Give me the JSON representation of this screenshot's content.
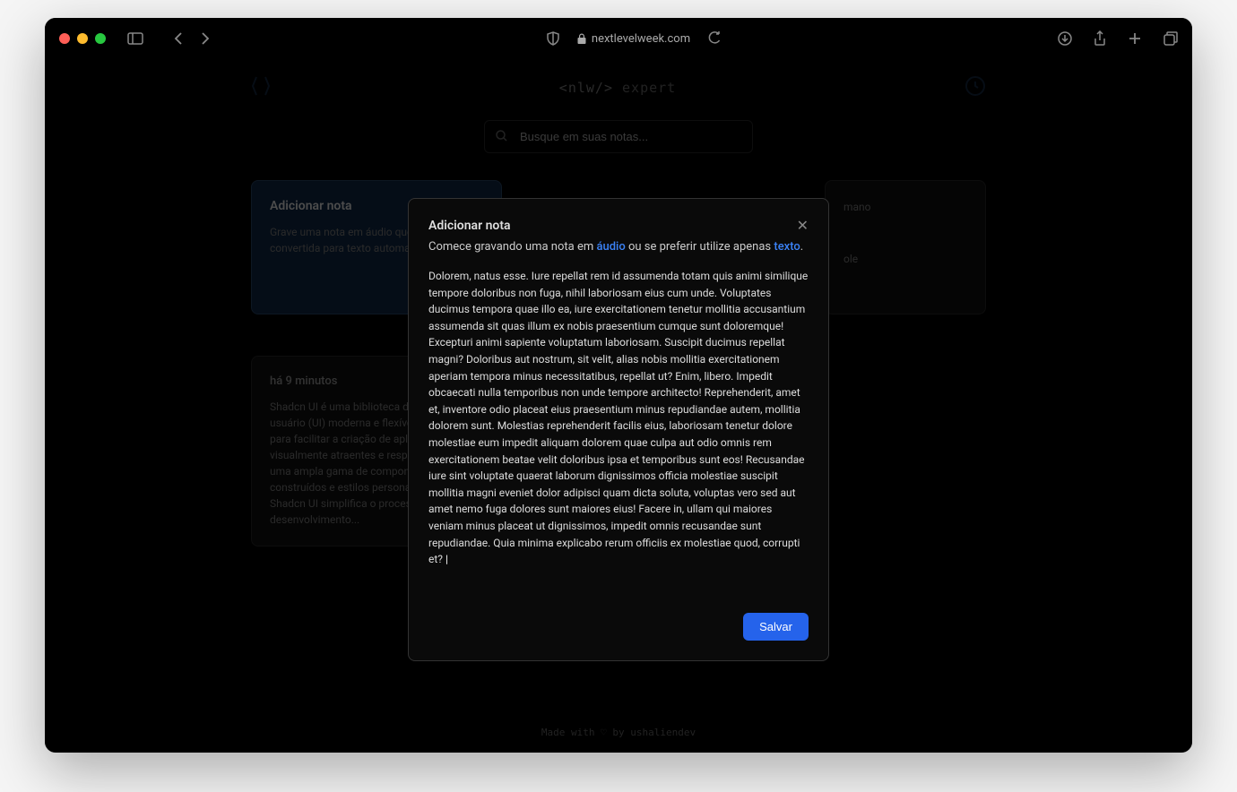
{
  "browser": {
    "url": "nextlevelweek.com"
  },
  "header": {
    "brand_prefix": "<nlw/>",
    "brand_suffix": "expert"
  },
  "search": {
    "placeholder": "Busque em suas notas..."
  },
  "cards": {
    "add": {
      "title": "Adicionar nota",
      "desc": "Grave uma nota em áudio que será convertida para texto automaticamente."
    },
    "note_mid": {
      "line1": "mano",
      "line2": "ole"
    },
    "note2": {
      "time": "há 9 minutos",
      "desc": "Shadcn UI é uma biblioteca de interface de usuário (UI) moderna e flexível, desenvolvida para facilitar a criação de aplicativos da web visualmente atraentes e responsivos. Com uma ampla gama de componentes pré-construídos e estilos personalizáveis, Shadcn UI simplifica o processo de design e desenvolvimento..."
    }
  },
  "modal": {
    "title": "Adicionar nota",
    "subtitle_pre": "Comece gravando uma nota em ",
    "subtitle_audio": "áudio",
    "subtitle_mid": " ou se preferir utilize apenas ",
    "subtitle_texto": "texto",
    "subtitle_post": ".",
    "body": "Dolorem, natus esse. Iure repellat rem id assumenda totam quis animi similique tempore doloribus non fuga, nihil laboriosam eius cum unde. Voluptates ducimus tempora quae illo ea, iure exercitationem tenetur mollitia accusantium assumenda sit quas illum ex nobis praesentium cumque sunt doloremque! Excepturi animi sapiente voluptatum laboriosam. Suscipit ducimus repellat magni? Doloribus aut nostrum, sit velit, alias nobis mollitia exercitationem aperiam tempora minus necessitatibus, repellat ut? Enim, libero. Impedit obcaecati nulla temporibus non unde tempore architecto! Reprehenderit, amet et, inventore odio placeat eius praesentium minus repudiandae autem, mollitia dolorem sunt. Molestias reprehenderit facilis eius, laboriosam tenetur dolore molestiae eum impedit aliquam dolorem quae culpa aut odio omnis rem exercitationem beatae velit doloribus ipsa et temporibus sunt eos! Recusandae iure sint voluptate quaerat laborum dignissimos officia molestiae suscipit mollitia magni eveniet dolor adipisci quam dicta soluta, voluptas vero sed aut amet nemo fuga dolores sunt maiores eius! Facere in, ullam qui maiores veniam minus placeat ut dignissimos, impedit omnis recusandae sunt repudiandae. Quia minima explicabo rerum officiis ex molestiae quod, corrupti et?",
    "save_label": "Salvar"
  },
  "footer": {
    "text": "Made with ♡ by ushaliendev"
  }
}
